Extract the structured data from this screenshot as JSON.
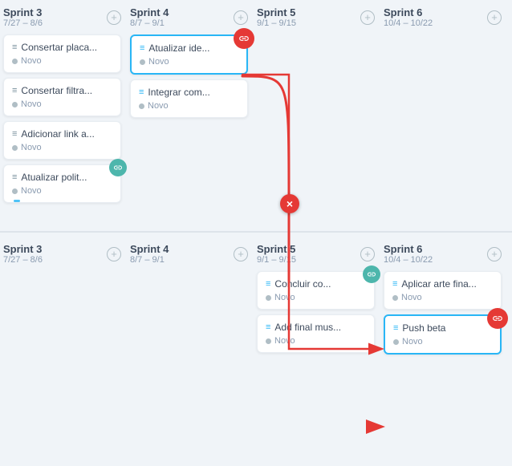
{
  "board": {
    "topSection": {
      "columns": [
        {
          "id": "sprint3-top",
          "title": "Sprint 3",
          "dates": "7/27 – 8/6",
          "cards": [
            {
              "id": "c1",
              "title": "Consertar placa...",
              "status": "Novo",
              "highlighted": false,
              "hasIndicator": false
            },
            {
              "id": "c2",
              "title": "Consertar filtra...",
              "status": "Novo",
              "highlighted": false,
              "hasIndicator": false
            },
            {
              "id": "c3",
              "title": "Adicionar link a...",
              "status": "Novo",
              "highlighted": false,
              "hasIndicator": false
            },
            {
              "id": "c4",
              "title": "Atualizar polit...",
              "status": "Novo",
              "highlighted": false,
              "hasIndicator": true
            }
          ]
        },
        {
          "id": "sprint4-top",
          "title": "Sprint 4",
          "dates": "8/7 – 9/1",
          "cards": [
            {
              "id": "c5",
              "title": "Atualizar ide...",
              "status": "Novo",
              "highlighted": true,
              "hasLinkBadge": true,
              "hasIndicator": false
            },
            {
              "id": "c6",
              "title": "Integrar com...",
              "status": "Novo",
              "highlighted": false,
              "hasIndicator": false
            }
          ]
        },
        {
          "id": "sprint5-top",
          "title": "Sprint 5",
          "dates": "9/1 – 9/15",
          "cards": []
        },
        {
          "id": "sprint6-top",
          "title": "Sprint 6",
          "dates": "10/4 – 10/22",
          "cards": []
        }
      ]
    },
    "bottomSection": {
      "columns": [
        {
          "id": "sprint3-bot",
          "title": "Sprint 3",
          "dates": "7/27 – 8/6",
          "cards": []
        },
        {
          "id": "sprint4-bot",
          "title": "Sprint 4",
          "dates": "8/7 – 9/1",
          "cards": []
        },
        {
          "id": "sprint5-bot",
          "title": "Sprint 5",
          "dates": "9/1 – 9/15",
          "cards": [
            {
              "id": "c7",
              "title": "Concluir co...",
              "status": "Novo",
              "highlighted": false,
              "hasLinkBadge2": true
            },
            {
              "id": "c8",
              "title": "Add final mus...",
              "status": "Novo",
              "highlighted": false
            }
          ]
        },
        {
          "id": "sprint6-bot",
          "title": "Sprint 6",
          "dates": "10/4 – 10/22",
          "cards": [
            {
              "id": "c9",
              "title": "Aplicar arte fina...",
              "status": "Novo",
              "highlighted": false
            },
            {
              "id": "c10",
              "title": "Push beta",
              "status": "Novo",
              "highlighted": true,
              "hasLinkBadge": true
            }
          ]
        }
      ]
    },
    "addButtonLabel": "+",
    "statusLabel": "Novo",
    "cancelIcon": "×"
  }
}
